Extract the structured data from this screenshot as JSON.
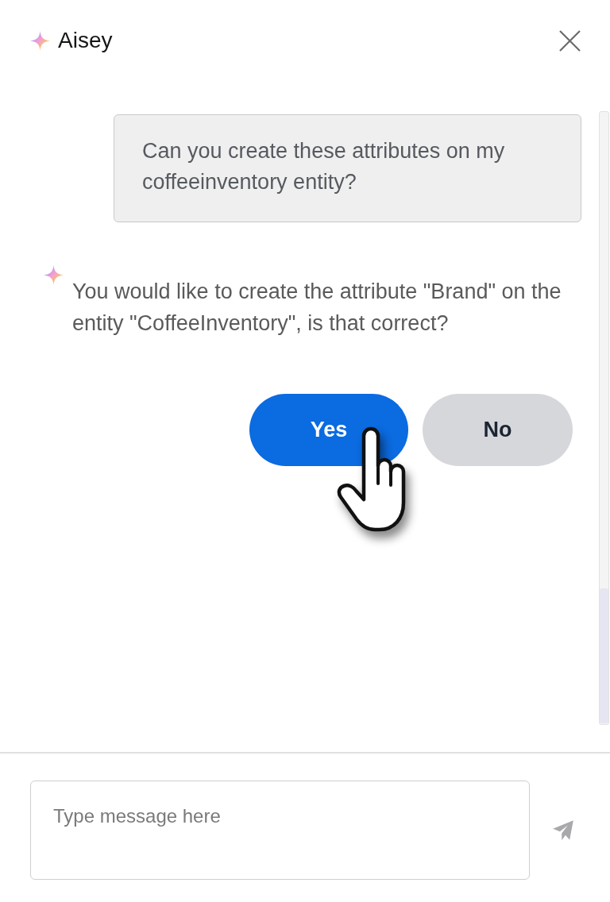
{
  "header": {
    "title": "Aisey"
  },
  "messages": [
    {
      "kind": "user",
      "text": "Can you create these attributes on my coffeeinventory entity?"
    },
    {
      "kind": "assistant",
      "text": "You would like to create the attribute \"Brand\" on the entity \"CoffeeInventory\", is that correct?"
    }
  ],
  "quick_replies": [
    {
      "kind": "primary",
      "label": "Yes"
    },
    {
      "kind": "secondary",
      "label": "No"
    }
  ],
  "composer": {
    "placeholder": "Type message here"
  }
}
